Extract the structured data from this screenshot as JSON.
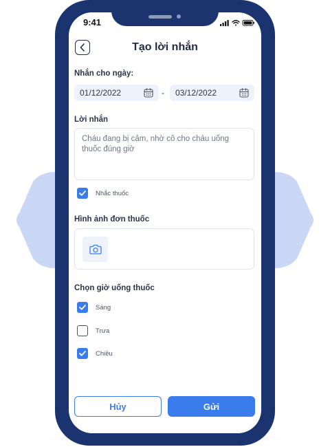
{
  "status_bar": {
    "time": "9:41"
  },
  "header": {
    "title": "Tạo lời nhắn"
  },
  "date_section": {
    "label": "Nhắn cho ngày:",
    "start_date": "01/12/2022",
    "separator": "-",
    "end_date": "03/12/2022"
  },
  "message_section": {
    "label": "Lời nhắn",
    "text": "Cháu đang bị cảm, nhờ cô cho cháu uống thuốc đúng giờ"
  },
  "reminder": {
    "label": "Nhắc thuốc",
    "checked": true
  },
  "prescription_section": {
    "label": "Hình ảnh đơn thuốc"
  },
  "time_section": {
    "label": "Chọn giờ uống thuốc",
    "options": [
      {
        "label": "Sáng",
        "checked": true
      },
      {
        "label": "Trưa",
        "checked": false
      },
      {
        "label": "Chiều",
        "checked": true
      }
    ]
  },
  "actions": {
    "cancel_label": "Hủy",
    "send_label": "Gửi"
  },
  "colors": {
    "frame": "#1b3470",
    "accent": "#3b7ced",
    "background_shape": "#c9d7f4"
  }
}
